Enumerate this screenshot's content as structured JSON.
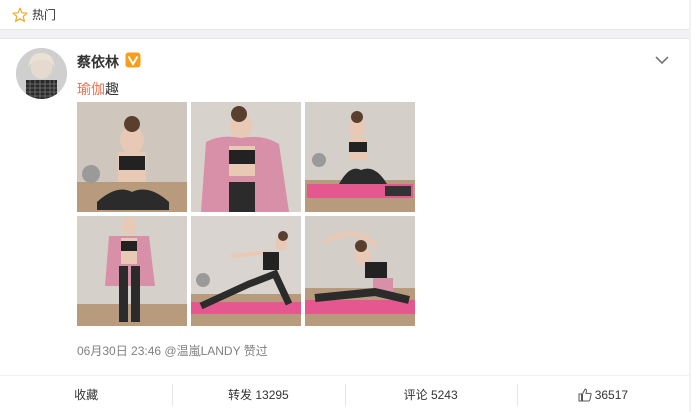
{
  "hot_bar": {
    "label": "热门"
  },
  "post": {
    "author": "蔡依林",
    "text_topic": "瑜伽",
    "text_rest": "趣",
    "timestamp": "06月30日 23:46",
    "approved_by": "@温嵐LANDY 赞过",
    "photos": [
      {
        "desc": "seated-pose"
      },
      {
        "desc": "standing-pink-jacket"
      },
      {
        "desc": "sitting-on-mat"
      },
      {
        "desc": "standing-full-body"
      },
      {
        "desc": "side-lunge-stretch"
      },
      {
        "desc": "seated-side-bend"
      }
    ]
  },
  "actions": {
    "favorite_label": "收藏",
    "repost_label": "转发",
    "repost_count": "13295",
    "comment_label": "评论",
    "comment_count": "5243",
    "like_count": "36517"
  },
  "colors": {
    "topic_link": "#eb7350",
    "meta_gray": "#808080",
    "verify_orange": "#f79e1b"
  }
}
